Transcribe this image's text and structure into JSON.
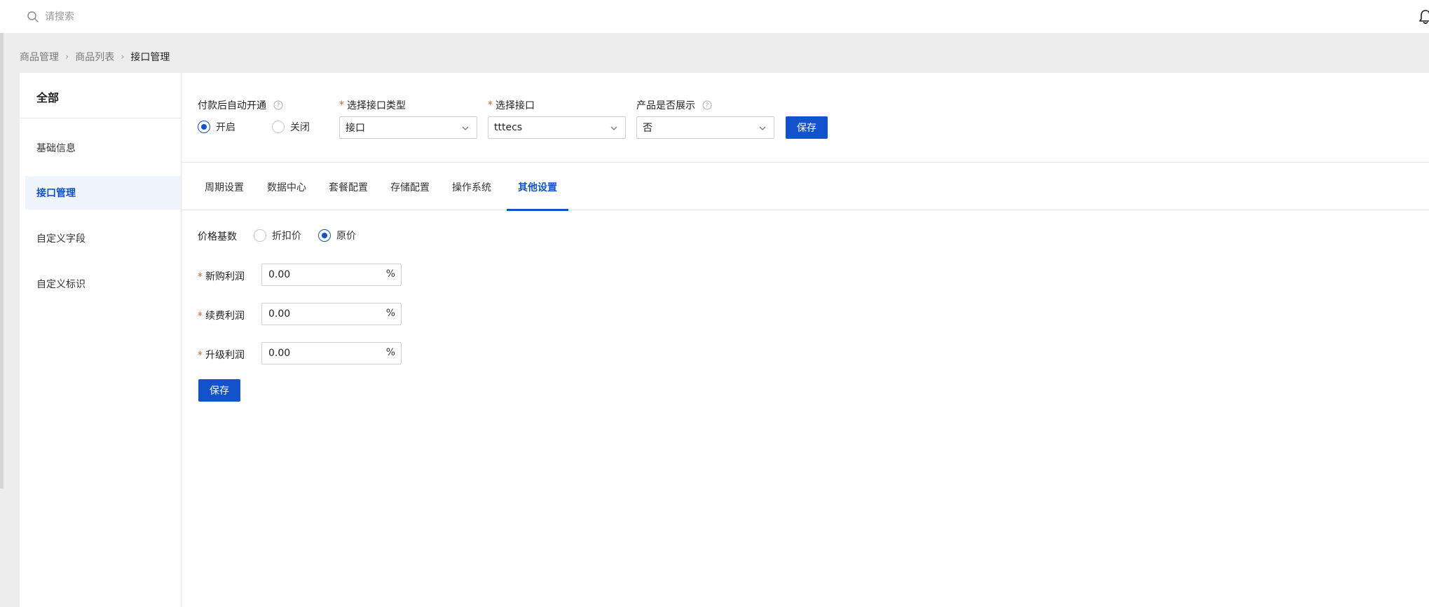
{
  "search": {
    "placeholder": "请搜索"
  },
  "breadcrumb": [
    "商品管理",
    "商品列表",
    "接口管理"
  ],
  "breadcrumb_separator": "›",
  "sidebar": {
    "title": "全部",
    "items": [
      {
        "label": "基础信息",
        "active": false
      },
      {
        "label": "接口管理",
        "active": true
      },
      {
        "label": "自定义字段",
        "active": false
      },
      {
        "label": "自定义标识",
        "active": false
      }
    ]
  },
  "config": {
    "auto_open": {
      "label": "付款后自动开通",
      "options": [
        {
          "label": "开启",
          "checked": true
        },
        {
          "label": "关闭",
          "checked": false
        }
      ]
    },
    "interface_type": {
      "label": "选择接口类型",
      "required": "*",
      "value": "接口"
    },
    "interface": {
      "label": "选择接口",
      "required": "*",
      "value": "tttecs"
    },
    "product_display": {
      "label": "产品是否展示",
      "value": "否"
    },
    "save_label": "保存"
  },
  "tabs": [
    {
      "label": "周期设置",
      "active": false
    },
    {
      "label": "数据中心",
      "active": false
    },
    {
      "label": "套餐配置",
      "active": false
    },
    {
      "label": "存储配置",
      "active": false
    },
    {
      "label": "操作系统",
      "active": false
    },
    {
      "label": "其他设置",
      "active": true
    }
  ],
  "form": {
    "price_base": {
      "label": "价格基数",
      "options": [
        {
          "label": "折扣价",
          "checked": false
        },
        {
          "label": "原价",
          "checked": true
        }
      ]
    },
    "fields": [
      {
        "label": "新购利润",
        "required": "*",
        "value": "0.00",
        "suffix": "%"
      },
      {
        "label": "续费利润",
        "required": "*",
        "value": "0.00",
        "suffix": "%"
      },
      {
        "label": "升级利润",
        "required": "*",
        "value": "0.00",
        "suffix": "%"
      }
    ],
    "save_label": "保存"
  },
  "colors": {
    "accent": "#1252cc",
    "required": "#e05a2a",
    "page_bg": "#ededed",
    "active_item_bg": "#eff4fd"
  }
}
